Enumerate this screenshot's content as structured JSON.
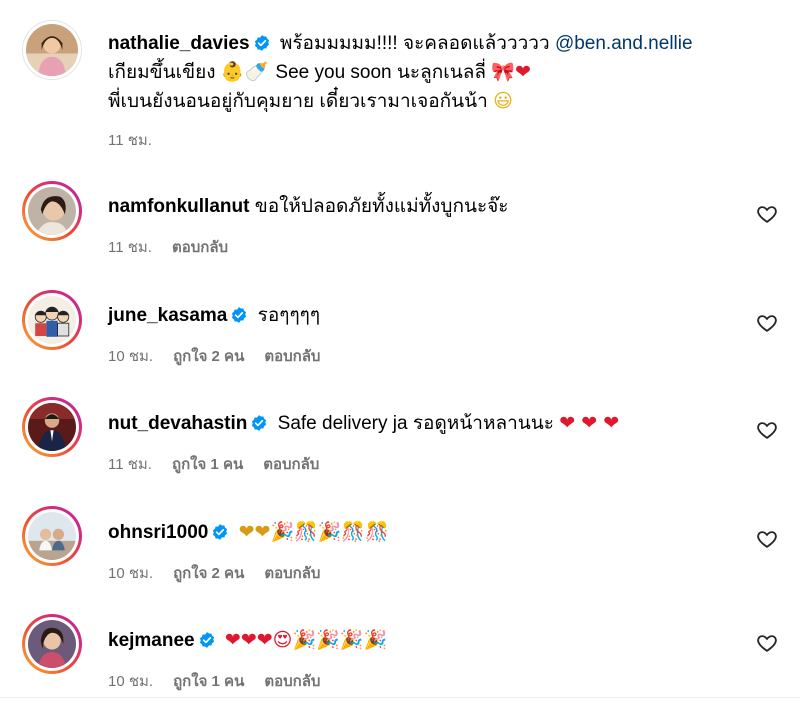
{
  "caption": {
    "username": "nathalie_davies",
    "verified": true,
    "line1_text": "พร้อมมมมม!!!! จะคลอดแล้ววววว",
    "mention": "@ben.and.nellie",
    "line2_text_a": "เกียมขึ้นเขียง",
    "line2_emoji_a": "👶🍼",
    "line2_text_b": "See you soon นะลูกเนลลี่",
    "line2_emoji_b": "🎀❤",
    "line3_text": "พี่เบนยังนอนอยู่กับคุมยาย เดี๋ยวเรามาเจอกันน้า",
    "line3_emoji": "😃",
    "time": "11 ชม."
  },
  "comments": [
    {
      "username": "namfonkullanut",
      "verified": false,
      "text": "ขอให้ปลอดภัยทั้งแม่ทั้งบูกนะจ๊ะ",
      "emojis": "",
      "time": "11 ชม.",
      "likes": "",
      "reply": "ตอบกลับ"
    },
    {
      "username": "june_kasama",
      "verified": true,
      "text": "รอๆๆๆๆ",
      "emojis": "",
      "time": "10 ชม.",
      "likes": "ถูกใจ 2 คน",
      "reply": "ตอบกลับ"
    },
    {
      "username": "nut_devahastin",
      "verified": true,
      "text": "Safe delivery ja รอดูหน้าหลานนะ",
      "emojis": "❤ ❤ ❤",
      "time": "11 ชม.",
      "likes": "ถูกใจ 1 คน",
      "reply": "ตอบกลับ"
    },
    {
      "username": "ohnsri1000",
      "verified": true,
      "text": "",
      "emojis": "❤❤🎉🎊🎉🎊🎊",
      "time": "10 ชม.",
      "likes": "ถูกใจ 2 คน",
      "reply": "ตอบกลับ"
    },
    {
      "username": "kejmanee",
      "verified": true,
      "text": "",
      "emojis": "❤❤❤😍🎉🎉🎉🎉",
      "time": "10 ชม.",
      "likes": "ถูกใจ 1 คน",
      "reply": "ตอบกลับ"
    }
  ],
  "colors": {
    "verified_blue": "#0095f6",
    "mention_blue": "#00376b",
    "meta_gray": "#737373",
    "heart_red": "#e0182d"
  },
  "icons": {
    "like": "heart-outline-icon",
    "verified": "verified-badge-icon"
  }
}
